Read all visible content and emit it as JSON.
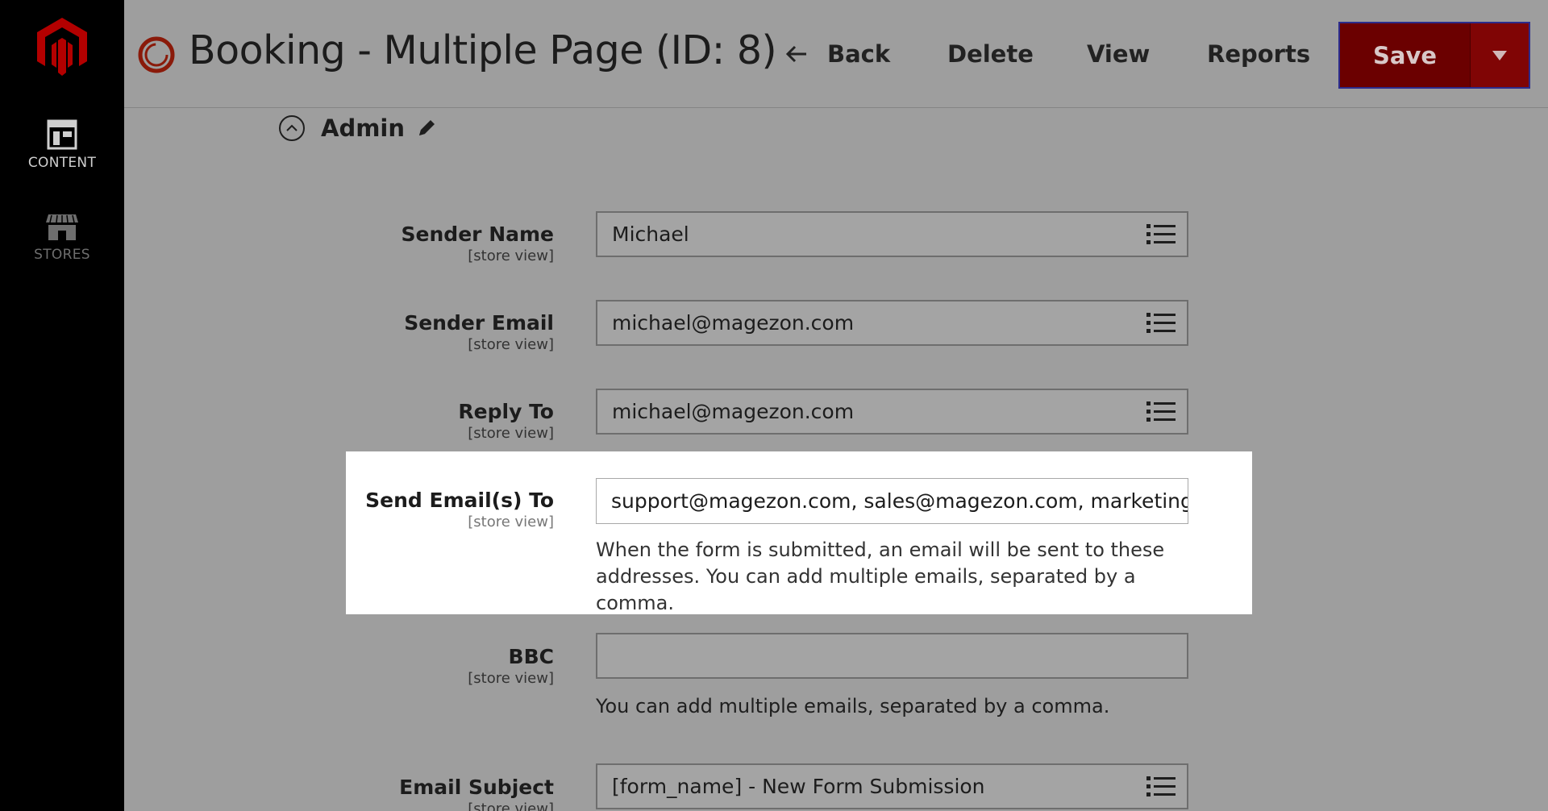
{
  "sidebar": {
    "items": [
      {
        "label": "CONTENT"
      },
      {
        "label": "STORES"
      }
    ]
  },
  "header": {
    "title": "Booking - Multiple Page (ID: 8)",
    "back_label": "Back",
    "delete_label": "Delete",
    "view_label": "View",
    "reports_label": "Reports",
    "save_label": "Save"
  },
  "section": {
    "title": "Admin"
  },
  "fields": {
    "sender_name": {
      "label": "Sender Name",
      "scope": "[store view]",
      "value": "Michael"
    },
    "sender_email": {
      "label": "Sender Email",
      "scope": "[store view]",
      "value": "michael@magezon.com"
    },
    "reply_to": {
      "label": "Reply To",
      "scope": "[store view]",
      "value": "michael@magezon.com"
    },
    "send_to": {
      "label": "Send Email(s) To",
      "scope": "[store view]",
      "value": "support@magezon.com, sales@magezon.com, marketing@m",
      "note": "When the form is submitted, an email will be sent to these addresses. You can add multiple emails, separated by a comma."
    },
    "bbc": {
      "label": "BBC",
      "scope": "[store view]",
      "value": "",
      "note": "You can add multiple emails, separated by a comma."
    },
    "email_subject": {
      "label": "Email Subject",
      "scope": "[store view]",
      "value": "[form_name] - New Form Submission"
    }
  },
  "colors": {
    "brand": "#6b0000",
    "sidebar": "#000000",
    "overlay": "#9e9e9e",
    "highlight": "#ffffff"
  },
  "icons": [
    "magento-logo-icon",
    "content-icon",
    "stores-icon",
    "ring-icon",
    "arrow-left-icon",
    "chevron-down-icon",
    "collapse-icon",
    "pencil-icon",
    "list-icon"
  ]
}
